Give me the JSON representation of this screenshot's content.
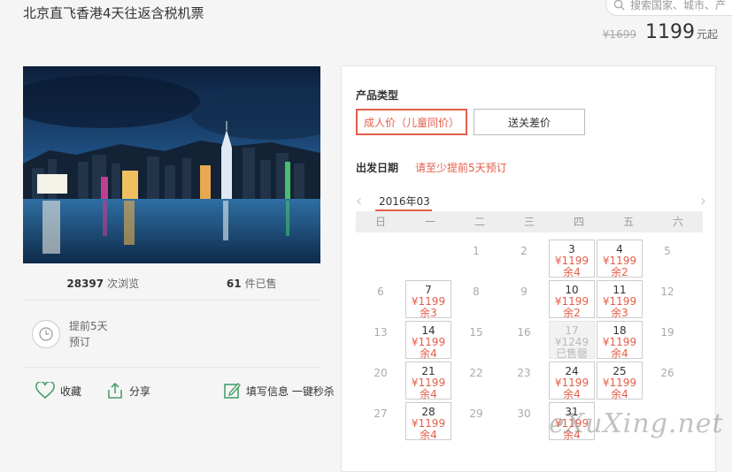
{
  "product": {
    "title": "北京直飞香港4天往返含税机票",
    "old_price": "¥1699",
    "price": "1199",
    "price_unit": "元起"
  },
  "search": {
    "placeholder": "搜索国家、城市、产"
  },
  "stats": {
    "views": "28397",
    "views_label": "次浏览",
    "sold": "61",
    "sold_label": "件已售"
  },
  "advance": {
    "line1": "提前5天",
    "line2": "预订"
  },
  "actions": {
    "favorite": "收藏",
    "share": "分享",
    "fill_info": "填写信息 一键秒杀"
  },
  "panel": {
    "product_type_label": "产品类型",
    "types": [
      "成人价（儿童同价）",
      "送关差价"
    ],
    "date_label": "出发日期",
    "date_notice": "请至少提前5天预订",
    "month": "2016年03",
    "weekdays": [
      "日",
      "一",
      "二",
      "三",
      "四",
      "五",
      "六"
    ]
  },
  "calendar": [
    {
      "day": "1",
      "status": "empty"
    },
    {
      "day": "2",
      "status": "empty"
    },
    {
      "day": "3",
      "status": "avail",
      "price": "¥1199",
      "stock": "余4"
    },
    {
      "day": "4",
      "status": "avail",
      "price": "¥1199",
      "stock": "余2"
    },
    {
      "day": "5",
      "status": "empty"
    },
    {
      "day": "6",
      "status": "empty"
    },
    {
      "day": "7",
      "status": "avail",
      "price": "¥1199",
      "stock": "余3"
    },
    {
      "day": "8",
      "status": "empty"
    },
    {
      "day": "9",
      "status": "empty"
    },
    {
      "day": "10",
      "status": "avail",
      "price": "¥1199",
      "stock": "余2"
    },
    {
      "day": "11",
      "status": "avail",
      "price": "¥1199",
      "stock": "余3"
    },
    {
      "day": "12",
      "status": "empty"
    },
    {
      "day": "13",
      "status": "empty"
    },
    {
      "day": "14",
      "status": "avail",
      "price": "¥1199",
      "stock": "余4"
    },
    {
      "day": "15",
      "status": "empty"
    },
    {
      "day": "16",
      "status": "empty"
    },
    {
      "day": "17",
      "status": "sold",
      "price": "¥1249",
      "stock": "已售罄"
    },
    {
      "day": "18",
      "status": "avail",
      "price": "¥1199",
      "stock": "余4"
    },
    {
      "day": "19",
      "status": "empty"
    },
    {
      "day": "20",
      "status": "empty"
    },
    {
      "day": "21",
      "status": "avail",
      "price": "¥1199",
      "stock": "余4"
    },
    {
      "day": "22",
      "status": "empty"
    },
    {
      "day": "23",
      "status": "empty"
    },
    {
      "day": "24",
      "status": "avail",
      "price": "¥1199",
      "stock": "余4"
    },
    {
      "day": "25",
      "status": "avail",
      "price": "¥1199",
      "stock": "余4"
    },
    {
      "day": "26",
      "status": "empty"
    },
    {
      "day": "27",
      "status": "empty"
    },
    {
      "day": "28",
      "status": "avail",
      "price": "¥1199",
      "stock": "余4"
    },
    {
      "day": "29",
      "status": "empty"
    },
    {
      "day": "30",
      "status": "empty"
    },
    {
      "day": "31",
      "status": "avail",
      "price": "¥1199",
      "stock": "余4"
    }
  ],
  "watermark": "eXuXing.net",
  "colors": {
    "accent": "#e45e4a",
    "panel_bg": "#ffffff",
    "page_bg": "#f5f5f5"
  },
  "icons": {
    "search": "search-icon",
    "clock": "clock-icon",
    "favorite": "heart-icon",
    "share": "share-icon",
    "fill": "edit-icon"
  }
}
